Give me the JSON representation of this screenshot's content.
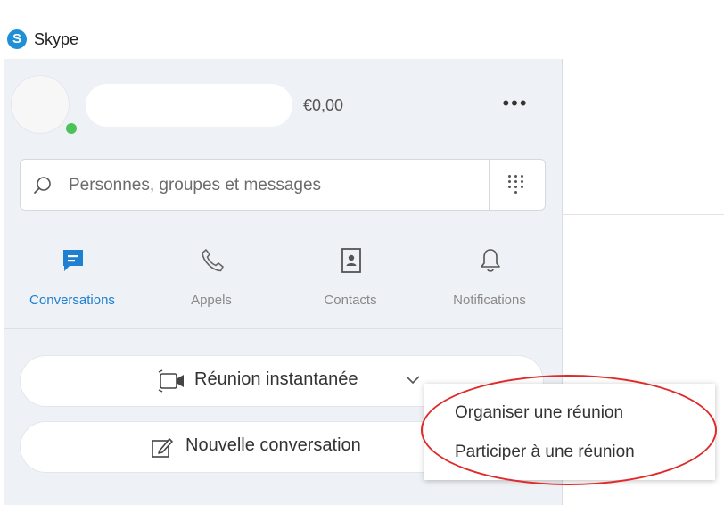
{
  "app": {
    "title": "Skype",
    "logo_letter": "S",
    "accent_color": "#1f8fd6"
  },
  "profile": {
    "credit": "€0,00",
    "presence_color": "#4cc35a",
    "more_label": "•••"
  },
  "search": {
    "placeholder": "Personnes, groupes et messages"
  },
  "tabs": [
    {
      "label": "Conversations",
      "icon": "chat-icon",
      "active": true
    },
    {
      "label": "Appels",
      "icon": "phone-icon",
      "active": false
    },
    {
      "label": "Contacts",
      "icon": "contacts-icon",
      "active": false
    },
    {
      "label": "Notifications",
      "icon": "bell-icon",
      "active": false
    }
  ],
  "actions": {
    "instant_meeting": "Réunion instantanée",
    "new_conversation": "Nouvelle conversation"
  },
  "dropdown": {
    "items": [
      "Organiser une réunion",
      "Participer à une réunion"
    ]
  },
  "colors": {
    "active_tab": "#1f7fd0",
    "highlight": "#e02a2a"
  }
}
